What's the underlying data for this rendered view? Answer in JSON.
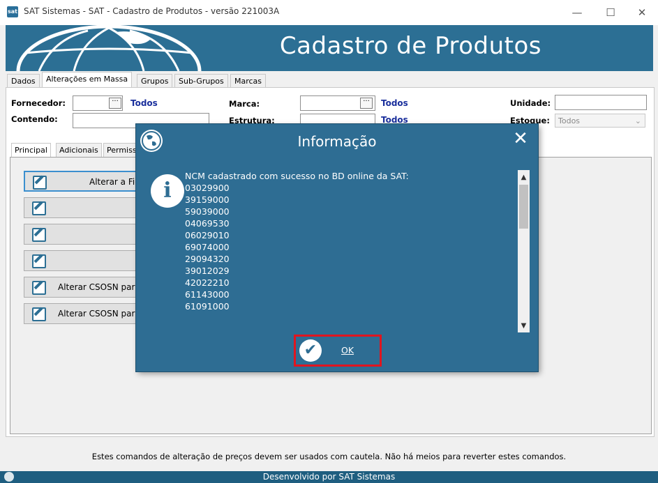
{
  "window": {
    "title": "SAT Sistemas - SAT - Cadastro de Produtos - versão 221003A",
    "minimize": "—",
    "maximize": "☐",
    "close": "✕"
  },
  "banner": {
    "title": "Cadastro de Produtos"
  },
  "tabs": [
    "Dados",
    "Alterações em Massa",
    "Grupos",
    "Sub-Grupos",
    "Marcas"
  ],
  "filters": {
    "fornecedor_label": "Fornecedor:",
    "fornecedor_todos": "Todos",
    "marca_label": "Marca:",
    "marca_todos": "Todos",
    "unidade_label": "Unidade:",
    "contendo_label": "Contendo:",
    "estrutura_label": "Estrutura:",
    "estrutura_todos": "Todos",
    "estoque_label": "Estoque:",
    "estoque_value": "Todos",
    "dots": "···"
  },
  "subtabs": [
    "Principal",
    "Adicionais",
    "Permiss"
  ],
  "actions": {
    "btn1": "Alterar a Fig",
    "btn5": "Alterar CSOSN para",
    "btn6": "Alterar CSOSN para"
  },
  "footer_note": "Estes comandos de alteração de preços devem ser usados com cautela. Não há meios para reverter estes comandos.",
  "statusbar": "Desenvolvido por SAT Sistemas",
  "modal": {
    "title": "Informação",
    "close": "✕",
    "info_icon": "i",
    "message_header": "NCM cadastrado com sucesso no BD online da SAT:",
    "ncm_codes": [
      "03029900",
      "39159000",
      "59039000",
      "04069530",
      "06029010",
      "69074000",
      "29094320",
      "39012029",
      "42022210",
      "61143000",
      "61091000"
    ],
    "ok_label": "OK",
    "ok_check": "✔",
    "scroll_up": "▲",
    "scroll_down": "▼"
  },
  "colors": {
    "primary": "#2e6d93",
    "highlight": "#e0151f",
    "link": "#1a2f9c"
  }
}
